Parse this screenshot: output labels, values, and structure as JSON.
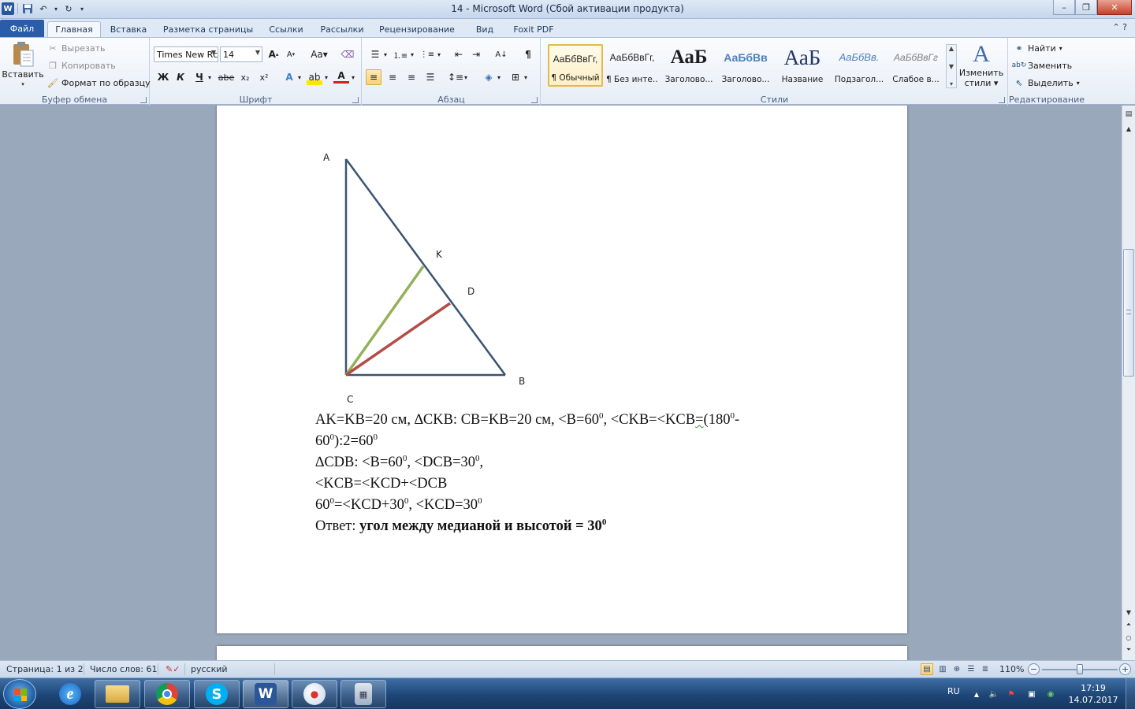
{
  "window": {
    "title": "14  -  Microsoft Word (Сбой активации продукта)",
    "app_icon": "W"
  },
  "tabs": [
    "Файл",
    "Главная",
    "Вставка",
    "Разметка страницы",
    "Ссылки",
    "Рассылки",
    "Рецензирование",
    "Вид",
    "Foxit PDF"
  ],
  "active_tab": "Главная",
  "ribbon": {
    "clipboard": {
      "paste": "Вставить",
      "cut": "Вырезать",
      "copy": "Копировать",
      "format_painter": "Формат по образцу",
      "label": "Буфер обмена"
    },
    "font": {
      "name": "Times New Rc",
      "size": "14",
      "bold": "Ж",
      "italic": "К",
      "underline": "Ч",
      "strike": "abe",
      "label": "Шрифт"
    },
    "paragraph": {
      "label": "Абзац"
    },
    "styles": {
      "items": [
        {
          "preview": "АаБбВвГг,",
          "name": "¶ Обычный"
        },
        {
          "preview": "АаБбВвГг,",
          "name": "¶ Без инте..."
        },
        {
          "preview": "АаБ",
          "name": "Заголово..."
        },
        {
          "preview": "АаБбВв",
          "name": "Заголово..."
        },
        {
          "preview": "АаБ",
          "name": "Название"
        },
        {
          "preview": "АаБбВв.",
          "name": "Подзагол..."
        },
        {
          "preview": "АаБбВвГг",
          "name": "Слабое в..."
        }
      ],
      "change_line1": "Изменить",
      "change_line2": "стили",
      "label": "Стили"
    },
    "editing": {
      "find": "Найти",
      "replace": "Заменить",
      "select": "Выделить",
      "label": "Редактирование"
    }
  },
  "figure": {
    "points": {
      "A": "A",
      "K": "K",
      "D": "D",
      "B": "B",
      "C": "C"
    },
    "colors": {
      "triangle": "#3b5374",
      "median": "#93b159",
      "altitude": "#b44d47"
    }
  },
  "document": {
    "line1": {
      "a": "AK=KB=20 см, ∆CKB: CB=KB=20 см, <B=60",
      "a_sup": "0",
      "b": ", <CKB=<KCB",
      "c": "=",
      "d": "(180",
      "d_sup": "0",
      "e": "-"
    },
    "line2": {
      "a": "60",
      "a_sup": "0",
      "b": "):2=60",
      "b_sup": "0"
    },
    "line3": {
      "a": "∆CDB: <B=60",
      "a_sup": "0",
      "b": ", <DCB=30",
      "b_sup": "0",
      "c": ","
    },
    "line4": {
      "a": "<KCB=<KCD+<DCB"
    },
    "line5": {
      "a": "60",
      "a_sup": "0",
      "b": "=<KCD+30",
      "b_sup": "0",
      "c": ",   <KCD=30",
      "c_sup": "0"
    },
    "line6": {
      "a": "Ответ: ",
      "b": "угол между медианой и высотой =   30",
      "b_sup": "0"
    }
  },
  "status": {
    "page": "Страница: 1 из 2",
    "words": "Число слов: 61",
    "language": "русский",
    "zoom": "110%"
  },
  "taskbar": {
    "apps": [
      "explorer",
      "ie",
      "files",
      "chrome",
      "skype",
      "word",
      "paint",
      "calculator"
    ],
    "lang": "RU",
    "time": "17:19",
    "date": "14.07.2017"
  }
}
